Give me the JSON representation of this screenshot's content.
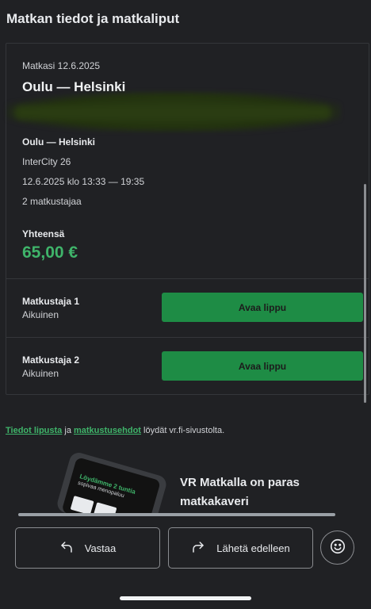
{
  "header": {
    "title": "Matkan tiedot ja matkaliput"
  },
  "trip": {
    "date_label": "Matkasi 12.6.2025",
    "route_title": "Oulu — Helsinki",
    "detail_route": "Oulu — Helsinki",
    "train": "InterCity 26",
    "time": "12.6.2025 klo 13:33 — 19:35",
    "travelers": "2 matkustajaa"
  },
  "total": {
    "label": "Yhteensä",
    "amount": "65,00 €"
  },
  "passengers": [
    {
      "name": "Matkustaja 1",
      "type": "Aikuinen",
      "button": "Avaa lippu"
    },
    {
      "name": "Matkustaja 2",
      "type": "Aikuinen",
      "button": "Avaa lippu"
    }
  ],
  "info": {
    "link1": "Tiedot lipusta",
    "mid": " ja ",
    "link2": "matkustusehdot",
    "end": " löydät vr.fi-sivustolta."
  },
  "promo": {
    "title": "VR Matkalla on paras matkakaveri",
    "phone_green_text": "Löydämme 2 tuntia",
    "phone_white_text": "sopivaa menopaluu"
  },
  "actions": {
    "reply": "Vastaa",
    "forward": "Lähetä edelleen"
  },
  "colors": {
    "accent_green": "#1e8c45",
    "price_green": "#3fb46a",
    "background": "#202124"
  },
  "icons": {
    "reply": "reply-arrow-icon",
    "forward": "forward-arrow-icon",
    "emoji": "smiley-icon"
  }
}
